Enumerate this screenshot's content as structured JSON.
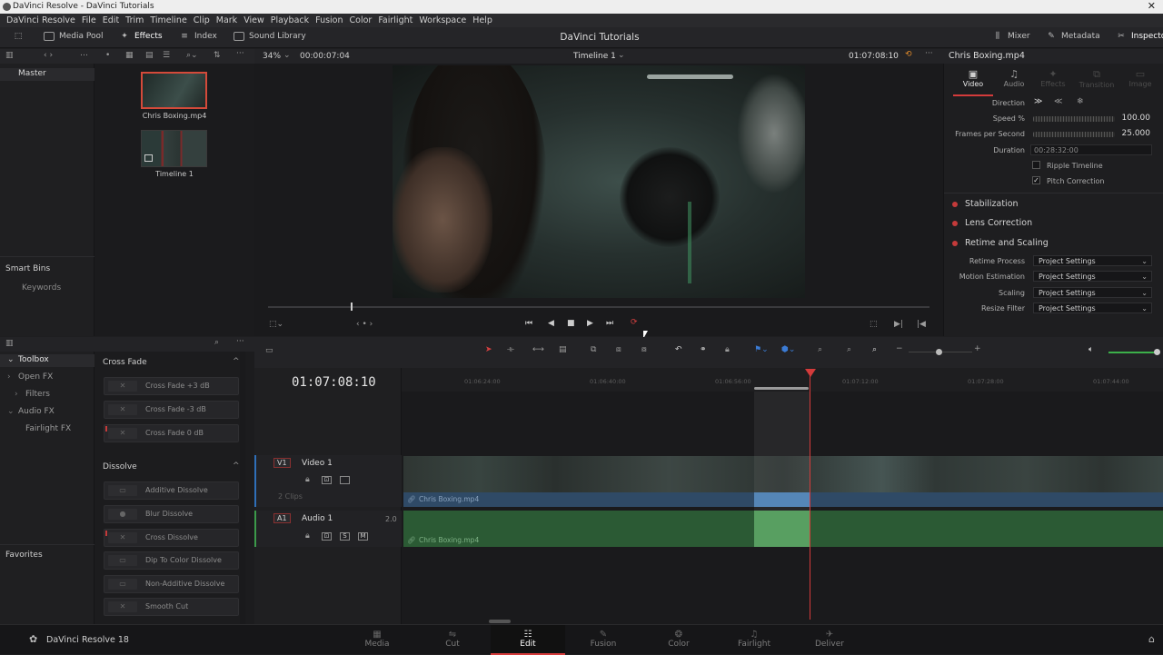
{
  "window": {
    "title": "DaVinci Resolve - DaVinci Tutorials"
  },
  "menu": [
    "DaVinci Resolve",
    "File",
    "Edit",
    "Trim",
    "Timeline",
    "Clip",
    "Mark",
    "View",
    "Playback",
    "Fusion",
    "Color",
    "Fairlight",
    "Workspace",
    "Help"
  ],
  "toolbar": {
    "media_pool": "Media Pool",
    "effects": "Effects",
    "index": "Index",
    "sound_library": "Sound Library",
    "project_title": "DaVinci Tutorials",
    "mixer": "Mixer",
    "metadata": "Metadata",
    "inspector": "Inspector"
  },
  "media_pool": {
    "bins": {
      "master": "Master",
      "smart_bins": "Smart Bins",
      "keywords": "Keywords",
      "favorites": "Favorites"
    },
    "clips": [
      {
        "name": "Chris Boxing.mp4"
      },
      {
        "name": "Timeline 1"
      }
    ]
  },
  "viewer": {
    "zoom": "34%",
    "source_tc": "00:00:07:04",
    "timeline_name": "Timeline 1",
    "record_tc": "01:07:08:10"
  },
  "inspector": {
    "clip_name": "Chris Boxing.mp4",
    "tabs": [
      "Video",
      "Audio",
      "Effects",
      "Transition",
      "Image"
    ],
    "direction_label": "Direction",
    "speed_label": "Speed %",
    "speed_value": "100.00",
    "fps_label": "Frames per Second",
    "fps_value": "25.000",
    "duration_label": "Duration",
    "duration_value": "00:28:32:00",
    "ripple_timeline": "Ripple Timeline",
    "pitch_correction": "Pitch Correction",
    "sections": [
      "Stabilization",
      "Lens Correction",
      "Retime and Scaling"
    ],
    "retime": [
      {
        "label": "Retime Process",
        "value": "Project Settings"
      },
      {
        "label": "Motion Estimation",
        "value": "Project Settings"
      },
      {
        "label": "Scaling",
        "value": "Project Settings"
      },
      {
        "label": "Resize Filter",
        "value": "Project Settings"
      }
    ]
  },
  "effects": {
    "tree": {
      "toolbox": "Toolbox",
      "open_fx": "Open FX",
      "filters": "Filters",
      "audio_fx": "Audio FX",
      "fairlight_fx": "Fairlight FX"
    },
    "cross_fade_title": "Cross Fade",
    "cross_fade": [
      "Cross Fade +3 dB",
      "Cross Fade -3 dB",
      "Cross Fade 0 dB"
    ],
    "dissolve_title": "Dissolve",
    "dissolve": [
      "Additive Dissolve",
      "Blur Dissolve",
      "Cross Dissolve",
      "Dip To Color Dissolve",
      "Non-Additive Dissolve",
      "Smooth Cut"
    ]
  },
  "timeline": {
    "timecode": "01:07:08:10",
    "ruler": [
      "01:06:24:00",
      "01:06:40:00",
      "01:06:56:00",
      "01:07:12:00",
      "01:07:28:00",
      "01:07:44:00"
    ],
    "video_track": {
      "tag": "V1",
      "name": "Video 1",
      "clips": "2 Clips",
      "clip_label": "Chris Boxing.mp4"
    },
    "audio_track": {
      "tag": "A1",
      "name": "Audio 1",
      "level": "2.0",
      "clip_label": "Chris Boxing.mp4",
      "solo": "S",
      "mute": "M"
    }
  },
  "pages": [
    "Media",
    "Cut",
    "Edit",
    "Fusion",
    "Color",
    "Fairlight",
    "Deliver"
  ],
  "active_page": "Edit",
  "app_name": "DaVinci Resolve 18",
  "colors": {
    "accent_red": "#d43b3b",
    "video_clip": "#2f4a66",
    "audio_clip": "#2b5a34"
  }
}
